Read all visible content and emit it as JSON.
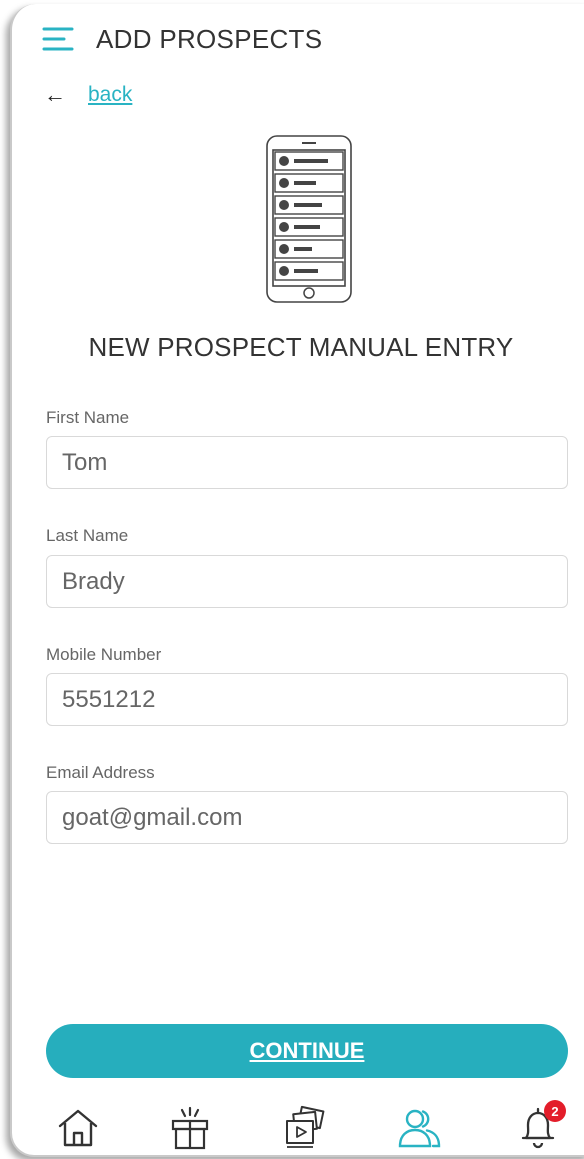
{
  "header": {
    "title": "ADD PROSPECTS",
    "menu_icon": "hamburger-menu-icon"
  },
  "back": {
    "arrow_icon": "arrow-left-icon",
    "label": "back"
  },
  "illustration": {
    "icon": "phone-contact-list-icon"
  },
  "section_title": "NEW PROSPECT MANUAL ENTRY",
  "form": {
    "first_name": {
      "label": "First Name",
      "value": "Tom"
    },
    "last_name": {
      "label": "Last Name",
      "value": "Brady"
    },
    "mobile": {
      "label": "Mobile Number",
      "value": "5551212"
    },
    "email": {
      "label": "Email Address",
      "value": "goat@gmail.com"
    }
  },
  "continue_label": "CONTINUE",
  "nav": {
    "items": [
      {
        "icon": "home-icon"
      },
      {
        "icon": "gift-box-icon"
      },
      {
        "icon": "media-cards-icon"
      },
      {
        "icon": "people-icon",
        "active": true
      },
      {
        "icon": "bell-icon",
        "badge": "2"
      }
    ]
  },
  "colors": {
    "accent": "#26aebd",
    "badge": "#e31d2a",
    "text": "#333333"
  }
}
